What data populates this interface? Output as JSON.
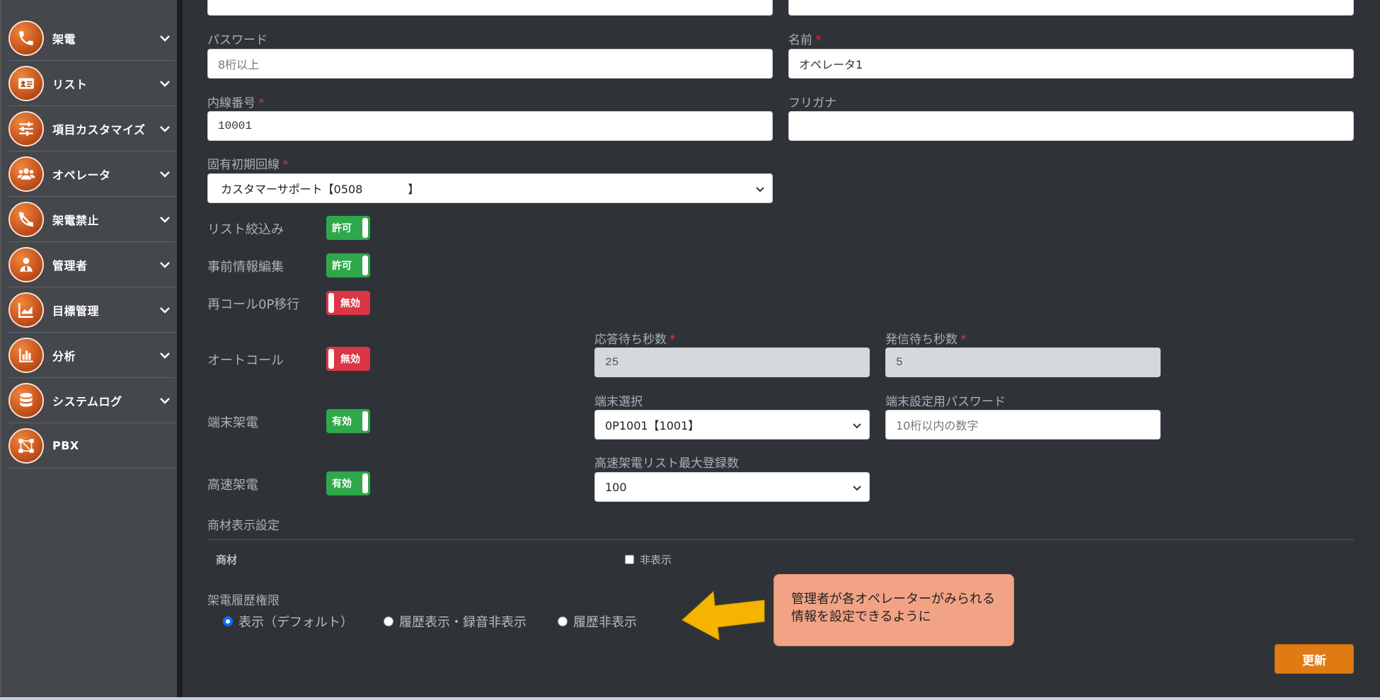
{
  "sidebar": {
    "items": [
      {
        "label": "架電",
        "icon": "phone-icon",
        "has_chevron": true
      },
      {
        "label": "リスト",
        "icon": "id-card-icon",
        "has_chevron": true
      },
      {
        "label": "項目カスタマイズ",
        "icon": "sliders-icon",
        "has_chevron": true
      },
      {
        "label": "オペレータ",
        "icon": "users-icon",
        "has_chevron": true
      },
      {
        "label": "架電禁止",
        "icon": "phone-slash-icon",
        "has_chevron": true
      },
      {
        "label": "管理者",
        "icon": "user-tie-icon",
        "has_chevron": true
      },
      {
        "label": "目標管理",
        "icon": "area-chart-icon",
        "has_chevron": true
      },
      {
        "label": "分析",
        "icon": "bar-chart-icon",
        "has_chevron": true
      },
      {
        "label": "システムログ",
        "icon": "database-icon",
        "has_chevron": true
      },
      {
        "label": "PBX",
        "icon": "network-icon",
        "has_chevron": false
      }
    ]
  },
  "form": {
    "password": {
      "label": "パスワード",
      "placeholder": "8桁以上"
    },
    "name": {
      "label": "名前",
      "required_mark": "*",
      "value": "オペレータ1"
    },
    "extension": {
      "label": "内線番号",
      "required_mark": "*",
      "value": "10001"
    },
    "furigana": {
      "label": "フリガナ",
      "value": ""
    },
    "line": {
      "label": "固有初期回線",
      "required_mark": "*",
      "value": "カスタマーサポート【0508　　　　】"
    },
    "list_filter": {
      "label": "リスト絞込み",
      "toggle": "許可",
      "state": "on"
    },
    "pre_info_edit": {
      "label": "事前情報編集",
      "toggle": "許可",
      "state": "on"
    },
    "recall_op": {
      "label": "再コール0P移行",
      "toggle": "無効",
      "state": "off"
    },
    "auto_call": {
      "label": "オートコール",
      "toggle": "無効",
      "state": "off"
    },
    "answer_wait": {
      "label": "応答待ち秒数",
      "required_mark": "*",
      "value": "25"
    },
    "dial_wait": {
      "label": "発信待ち秒数",
      "required_mark": "*",
      "value": "5"
    },
    "device_call": {
      "label": "端末架電",
      "toggle": "有効",
      "state": "on"
    },
    "device_select": {
      "label": "端末選択",
      "value": "0P1001【1001】"
    },
    "device_password": {
      "label": "端末設定用パスワード",
      "placeholder": "10桁以内の数字"
    },
    "fast_call": {
      "label": "高速架電",
      "toggle": "有効",
      "state": "on"
    },
    "fast_list_max": {
      "label": "高速架電リスト最大登録数",
      "value": "100"
    },
    "material_section": {
      "label": "商材表示設定"
    },
    "material": {
      "label": "商材",
      "checkbox_label": "非表示",
      "checked": false
    },
    "history": {
      "label": "架電履歴権限",
      "options": [
        "表示（デフォルト）",
        "履歴表示・録音非表示",
        "履歴非表示"
      ],
      "selected": 0
    }
  },
  "callout": {
    "text": "管理者が各オペレーターがみられる情報を設定できるように"
  },
  "actions": {
    "update_label": "更新"
  },
  "colors": {
    "accent": "#e07b14",
    "toggle_on": "#2ea84a",
    "toggle_off": "#dc3545",
    "callout_bg": "#f2a385",
    "arrow": "#f5b400"
  }
}
